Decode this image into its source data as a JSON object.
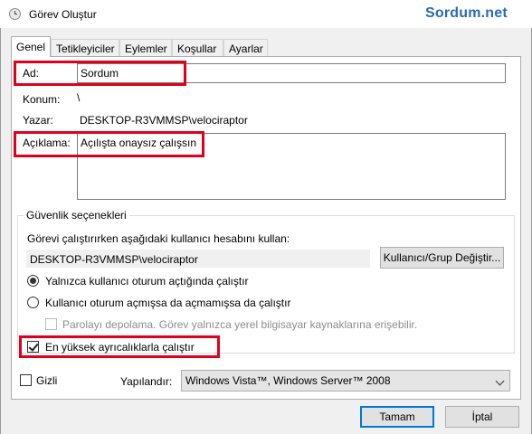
{
  "window": {
    "title": "Görev Oluştur",
    "watermark": "Sordum.net"
  },
  "tabs": [
    {
      "label": "Genel"
    },
    {
      "label": "Tetikleyiciler"
    },
    {
      "label": "Eylemler"
    },
    {
      "label": "Koşullar"
    },
    {
      "label": "Ayarlar"
    }
  ],
  "general": {
    "name_label": "Ad:",
    "name_value": "Sordum",
    "location_label": "Konum:",
    "location_value": "\\",
    "author_label": "Yazar:",
    "author_value": "DESKTOP-R3VMMSP\\velociraptor",
    "description_label": "Açıklama:",
    "description_value": "Açılışta onaysız çalışsın"
  },
  "security": {
    "group_title": "Güvenlik seçenekleri",
    "account_prompt": "Görevi çalıştırırken aşağıdaki kullanıcı hesabını kullan:",
    "account_value": "DESKTOP-R3VMMSP\\velociraptor",
    "change_user_button": "Kullanıcı/Grup Değiştir...",
    "radio_logged_on": "Yalnızca kullanıcı oturum açtığında çalıştır",
    "radio_whether": "Kullanıcı oturum açmışsa da açmamışsa da çalıştır",
    "no_store_password": "Parolayı depolama. Görev yalnızca yerel bilgisayar kaynaklarına erişebilir.",
    "highest_privileges": "En yüksek ayrıcalıklarla çalıştır",
    "radio_selected": "logged_on",
    "highest_checked": true
  },
  "footer": {
    "hidden_label": "Gizli",
    "configure_label": "Yapılandır:",
    "configure_value": "Windows Vista™, Windows Server™ 2008",
    "ok_button": "Tamam",
    "cancel_button": "İptal"
  },
  "colors": {
    "highlight": "#e0001b",
    "accent": "#0078d7",
    "watermark": "#2a6bb5"
  }
}
